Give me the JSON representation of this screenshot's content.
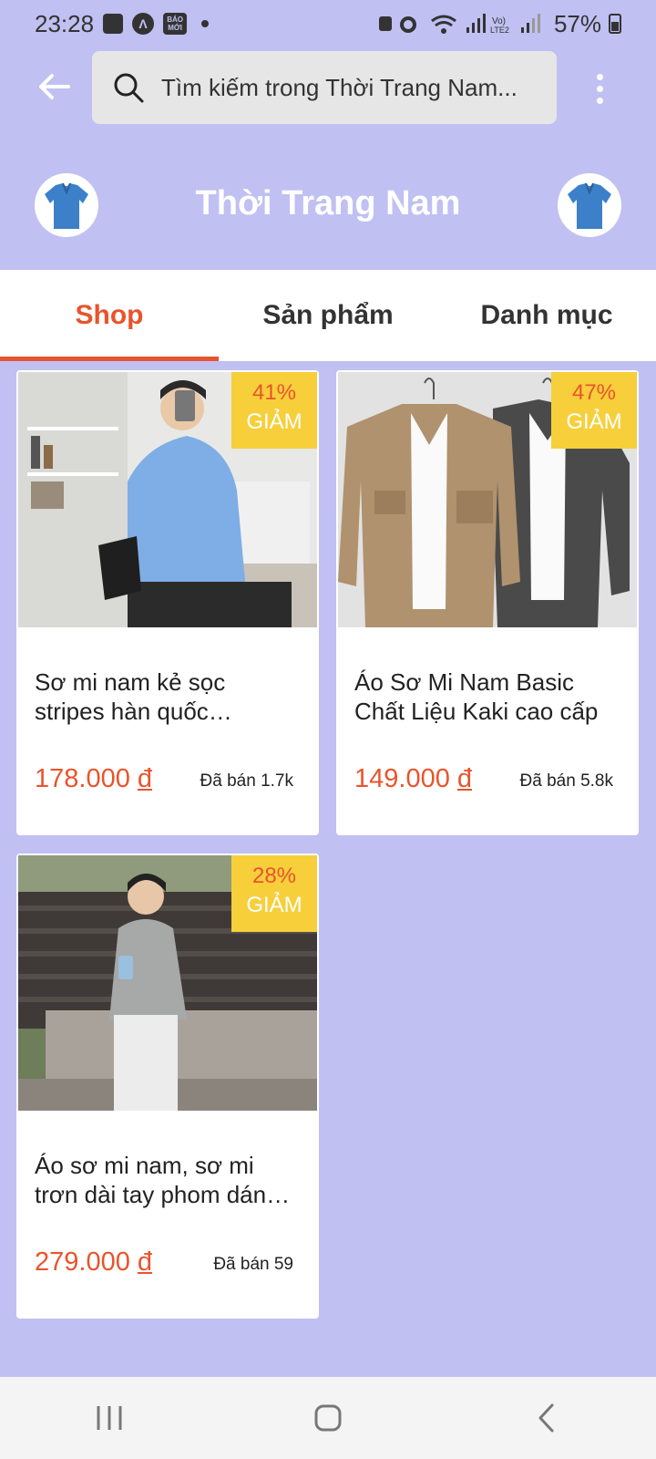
{
  "status_bar": {
    "time": "23:28",
    "battery": "57%",
    "icons": [
      "gallery-icon",
      "app-icon",
      "baomoi-icon",
      "wifi-icon",
      "signal-icon",
      "alarm-icon"
    ],
    "baomoi_text": "BÁO MỚI"
  },
  "header": {
    "search_placeholder": "Tìm kiếm trong Thời Trang Nam..."
  },
  "shop": {
    "name": "Thời Trang Nam"
  },
  "tabs": [
    {
      "label": "Shop",
      "active": true
    },
    {
      "label": "Sản phẩm",
      "active": false
    },
    {
      "label": "Danh mục",
      "active": false
    }
  ],
  "products": [
    {
      "title": "Sơ mi nam kẻ sọc stripes hàn quốc JABONE cao cấp",
      "price": "178.000",
      "currency": "đ",
      "sold": "Đã bán 1.7k",
      "discount_pct": "41%",
      "discount_label": "GIẢM"
    },
    {
      "title": "Áo Sơ Mi Nam Basic Chất Liệu Kaki cao cấp",
      "price": "149.000",
      "currency": "đ",
      "sold": "Đã bán 5.8k",
      "discount_pct": "47%",
      "discount_label": "GIẢM"
    },
    {
      "title": "Áo sơ mi nam, sơ mi trơn dài tay phom dáng rộng",
      "price": "279.000",
      "currency": "đ",
      "sold": "Đã bán 59",
      "discount_pct": "28%",
      "discount_label": "GIẢM"
    }
  ],
  "colors": {
    "accent": "#e8542d",
    "background": "#c0c0f2",
    "badge": "#f6cf3b"
  }
}
